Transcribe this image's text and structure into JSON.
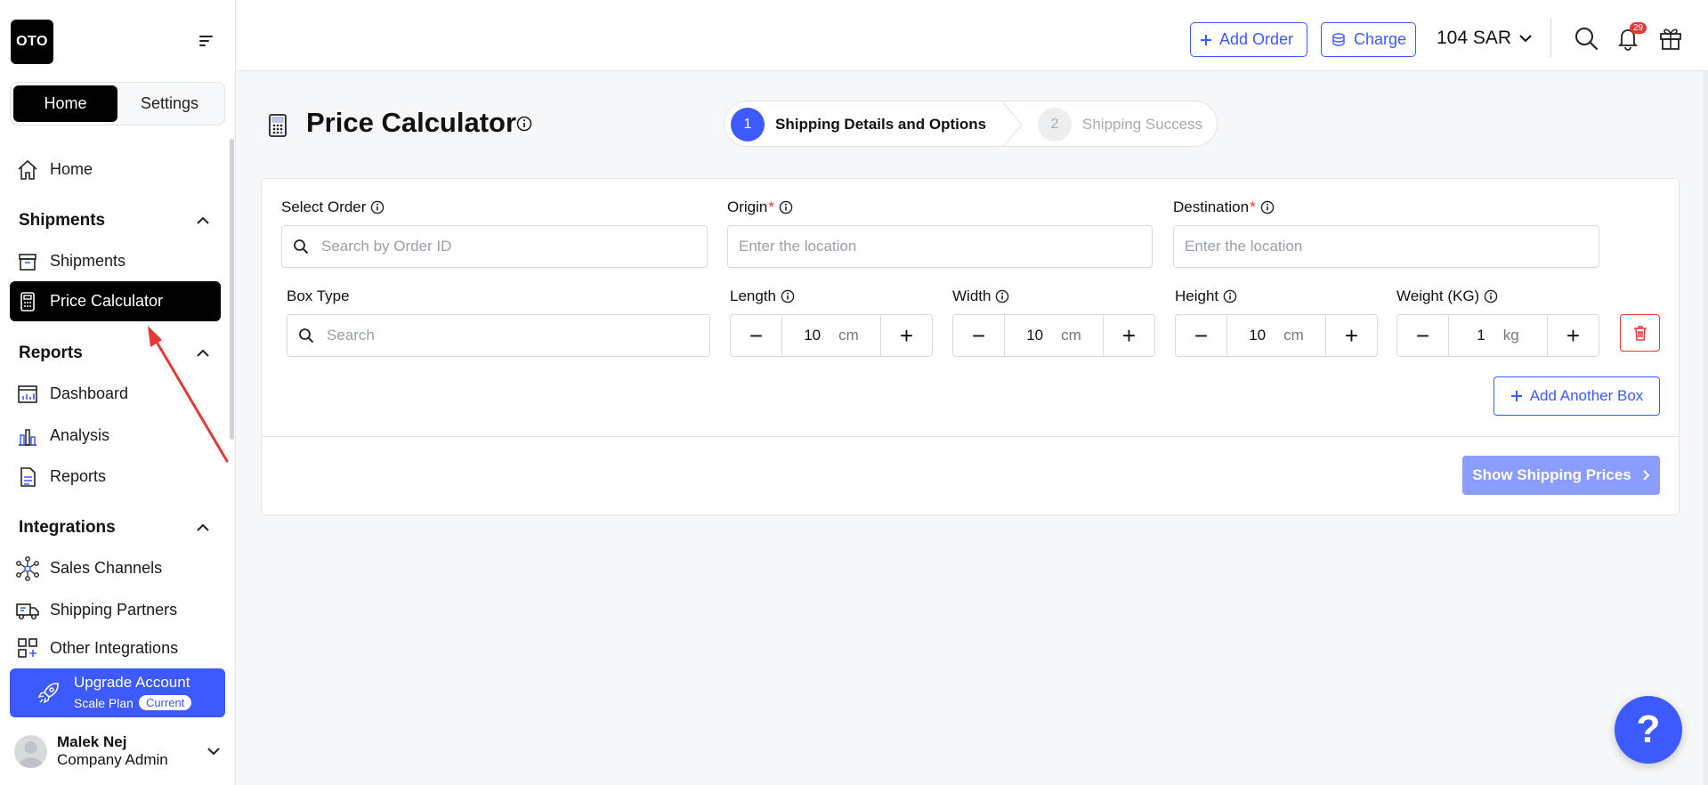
{
  "brand": {
    "logo_text": "OTO"
  },
  "sidebar": {
    "tabs": {
      "home": "Home",
      "settings": "Settings"
    },
    "home_item": "Home",
    "sections": [
      {
        "title": "Shipments",
        "items": [
          "Shipments",
          "Price Calculator"
        ]
      },
      {
        "title": "Reports",
        "items": [
          "Dashboard",
          "Analysis",
          "Reports"
        ]
      },
      {
        "title": "Integrations",
        "items": [
          "Sales Channels",
          "Shipping Partners",
          "Other Integrations"
        ]
      }
    ],
    "active_item": "Price Calculator",
    "upgrade": {
      "title": "Upgrade Account",
      "plan": "Scale Plan",
      "badge": "Current"
    },
    "user": {
      "name": "Malek Nej",
      "role": "Company Admin"
    }
  },
  "topbar": {
    "add_order": "Add Order",
    "charge": "Charge",
    "balance": "104 SAR",
    "notifications_count": "29"
  },
  "page": {
    "title": "Price Calculator",
    "steps": [
      {
        "num": "1",
        "label": "Shipping Details and Options",
        "active": true
      },
      {
        "num": "2",
        "label": "Shipping Success",
        "active": false
      }
    ]
  },
  "form": {
    "select_order": {
      "label": "Select Order",
      "placeholder": "Search by Order ID"
    },
    "origin": {
      "label": "Origin",
      "required": "*",
      "placeholder": "Enter the location"
    },
    "destination": {
      "label": "Destination",
      "required": "*",
      "placeholder": "Enter the location"
    },
    "box_type": {
      "label": "Box Type",
      "placeholder": "Search"
    },
    "length": {
      "label": "Length",
      "value": "10",
      "unit": "cm"
    },
    "width": {
      "label": "Width",
      "value": "10",
      "unit": "cm"
    },
    "height": {
      "label": "Height",
      "value": "10",
      "unit": "cm"
    },
    "weight": {
      "label": "Weight (KG)",
      "value": "1",
      "unit": "kg"
    },
    "add_box": "Add Another Box",
    "show_prices": "Show Shipping Prices"
  },
  "help": {
    "label": "?"
  },
  "colors": {
    "accent": "#3d5afe",
    "danger": "#e53935",
    "disabled_accent": "#8b9cff"
  }
}
